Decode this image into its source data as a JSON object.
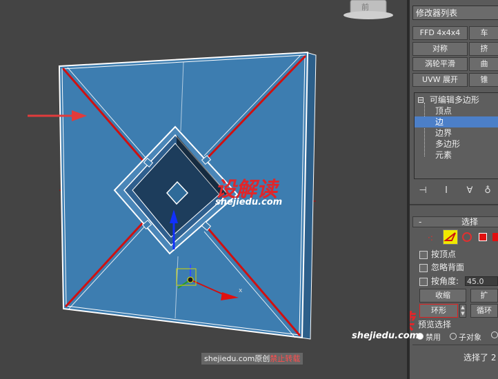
{
  "viewport": {
    "axis_label_x": "x"
  },
  "watermark": {
    "brand": "设解读",
    "domain": "shejiedu.com"
  },
  "caption": {
    "site": "shejiedu.com原创",
    "notice": "禁止转载"
  },
  "panel": {
    "modifier_list": "修改器列表",
    "buttons": [
      {
        "label": "FFD 4x4x4"
      },
      {
        "label": "车"
      },
      {
        "label": "对称"
      },
      {
        "label": "挤"
      },
      {
        "label": "涡轮平滑"
      },
      {
        "label": "曲"
      },
      {
        "label": "UVW 展开"
      },
      {
        "label": "锥"
      }
    ],
    "stack": {
      "root": "可编辑多边形",
      "expand_glyph": "⊟",
      "items": [
        "顶点",
        "边",
        "边界",
        "多边形",
        "元素"
      ],
      "selected": "边"
    },
    "selection": {
      "title": "选择",
      "collapse_glyph": "-",
      "by_vertex": "按顶点",
      "ignore_backfacing": "忽略背面",
      "by_angle": "按角度:",
      "angle_value": "45.0",
      "shrink": "收缩",
      "grow": "扩",
      "ring": "环形",
      "loop": "循环",
      "preview_title": "预览选择",
      "preview_off": "禁用",
      "preview_subobject": "子对象",
      "status": "选择了 2"
    }
  },
  "colors": {
    "viewport_bg": "#444444",
    "plane_fill": "#3d7db0",
    "selected_edge": "#d01010",
    "wire": "#ffffff",
    "panel_bg": "#5a5a5a",
    "stack_highlight": "#4c7fc8",
    "watermark_red": "#e0262a"
  }
}
